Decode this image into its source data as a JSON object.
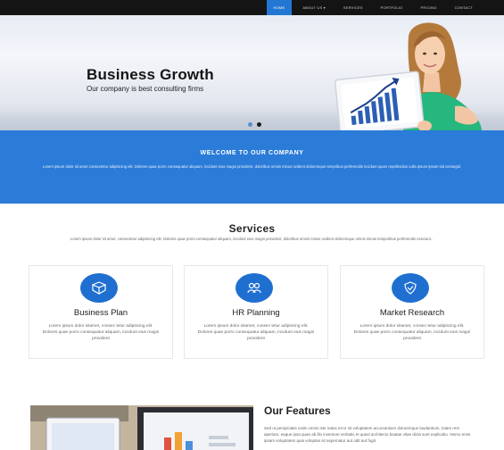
{
  "nav": {
    "items": [
      {
        "label": "Home",
        "active": true
      },
      {
        "label": "About us",
        "caret": "▾",
        "active": false
      },
      {
        "label": "Services",
        "active": false
      },
      {
        "label": "Portfolio",
        "active": false
      },
      {
        "label": "Pricing",
        "active": false
      },
      {
        "label": "Contact",
        "active": false
      }
    ]
  },
  "hero": {
    "title": "Business Growth",
    "subtitle": "Our company is best consulting firms",
    "slides_total": 2,
    "slide_active": 2
  },
  "welcome": {
    "title": "Welcome to our company",
    "text": "Lorem ipsum dolor sit amet consectetur adipisicing elit. Dolores quae porro consequatur aliquam, incidunt eius magni provident, doloribus omnis minus ovident doloremque tempribus perferendis incidunt quam repellendus culla ipsum ipsum sid consegid."
  },
  "services": {
    "title": "Services",
    "intro": "Lorem ipsum dolor sit amet, consectetur adipisicing elit. Dolores quae porro consequatur aliquam, incidunt eius magni provident, doloribus omnis minus ovident doloremque omnis minus temporibus perferendis nesciunt..",
    "cards": [
      {
        "title": "Business Plan",
        "icon": "box-icon",
        "text": "Lorem ipsum dolor sitamet, consec tetur adipiscing elit. Dolores quae porro consequatur aliquam, incidunt eius magni provident"
      },
      {
        "title": "HR Planning",
        "icon": "people-icon",
        "text": "Lorem ipsum dolor sitamet, consec tetur adipiscing elit. Dolores quae porro consequatur aliquam, incidunt eius magni provident"
      },
      {
        "title": "Market Research",
        "icon": "shield-icon",
        "text": "Lorem ipsum dolor sitamet, consec tetur adipiscing elit. Dolores quae porro consequatur aliquam, incidunt eius magni provident"
      }
    ]
  },
  "features": {
    "title": "Our Features",
    "text": "Sed ut perspiciatis unde omnis iste natus error sit voluptatem accusantium doloremque laudantium, totam rem aperiam, eaque ipsa quae ab illo inventore veritatis et quasi architecto beatae vitae dicta sunt explicabo. Nemo enim ipsam voluptatem quia voluptas sit aspernatur aut odit aut fugit."
  },
  "colors": {
    "accent": "#2277d2",
    "welcome_bg": "#2b7bd8",
    "nav_bg": "#141414",
    "icon_bg": "#1f6fd1"
  }
}
